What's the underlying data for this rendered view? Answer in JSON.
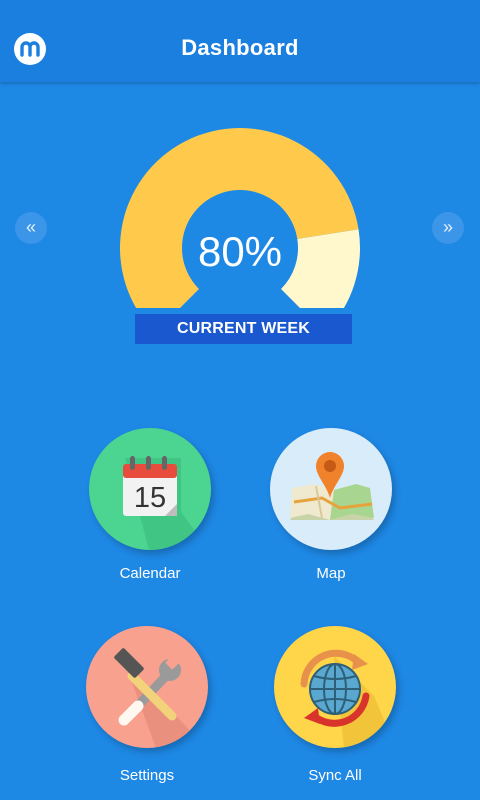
{
  "header": {
    "title": "Dashboard",
    "logo_icon": "m-logo-icon"
  },
  "gauge": {
    "value_text": "80%",
    "percent": 80,
    "label": "CURRENT WEEK",
    "prev_symbol": "«",
    "next_symbol": "»",
    "filled_color": "#ffca4b",
    "remaining_color": "#fff8cc"
  },
  "tiles": [
    {
      "label": "Calendar",
      "icon": "calendar-icon",
      "icon_text": "15",
      "circle_color": "#4cd491"
    },
    {
      "label": "Map",
      "icon": "map-pin-icon",
      "circle_color": "#d9ecfa"
    },
    {
      "label": "Settings",
      "icon": "hammer-wrench-icon",
      "circle_color": "#f8a18e"
    },
    {
      "label": "Sync All",
      "icon": "globe-sync-icon",
      "circle_color": "#ffd54a"
    }
  ]
}
